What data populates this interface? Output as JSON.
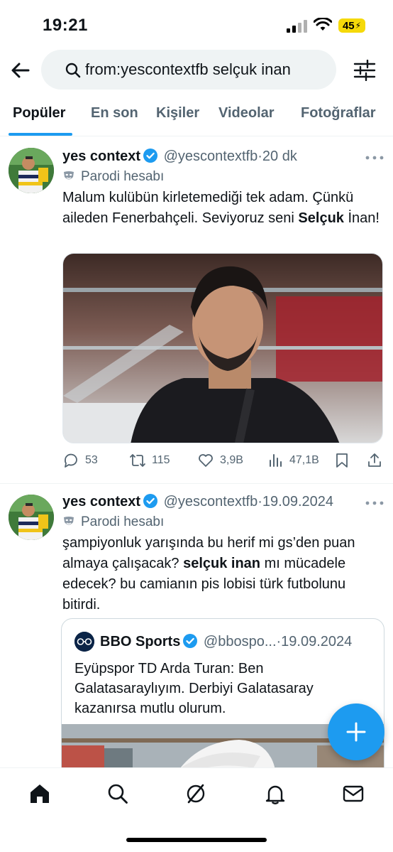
{
  "status_bar": {
    "time": "19:21",
    "battery": "45",
    "icons": [
      "signal-icon",
      "wifi-icon",
      "battery-icon"
    ]
  },
  "search": {
    "query": "from:yescontextfb selçuk inan",
    "icons": [
      "back-arrow-icon",
      "search-icon",
      "filter-sliders-icon"
    ]
  },
  "tabs": [
    {
      "label": "Popüler",
      "active": true
    },
    {
      "label": "En son",
      "active": false
    },
    {
      "label": "Kişiler",
      "active": false
    },
    {
      "label": "Videolar",
      "active": false
    },
    {
      "label": "Fotoğraflar",
      "active": false
    }
  ],
  "tweets": [
    {
      "author": "yes context",
      "handle": "@yescontextfb",
      "separator": "·",
      "time": "20 dk",
      "badge": "Parodi hesabı",
      "text_parts": {
        "before": "Malum kulübün kirletemediği tek adam. Çünkü aileden Fenerbahçeli. Seviyoruz seni ",
        "bold": "Selçuk",
        "after": " İnan!"
      },
      "stats": {
        "replies": "53",
        "retweets": "115",
        "likes": "3,9B",
        "views": "47,1B"
      }
    },
    {
      "author": "yes context",
      "handle": "@yescontextfb",
      "separator": "·",
      "time": "19.09.2024",
      "badge": "Parodi hesabı",
      "text_parts": {
        "before": "şampiyonluk yarışında bu herif mi gs’den puan almaya çalışacak? ",
        "bold": "selçuk inan",
        "after": " mı mücadele edecek? bu camianın pis lobisi türk futbolunu bitirdi."
      },
      "quote": {
        "author": "BBO Sports",
        "handle": "@bbospo...",
        "separator": "·",
        "time": "19.09.2024",
        "text": "Eyüpspor TD Arda Turan: Ben Galatasaraylıyım. Derbiyi Galatasaray kazanırsa mutlu olurum."
      }
    }
  ],
  "bottom_nav": [
    "home-icon",
    "search-icon",
    "grok-icon",
    "notifications-bell-icon",
    "messages-envelope-icon"
  ],
  "colors": {
    "accent": "#1d9bf0",
    "text": "#0f1419",
    "secondary": "#536471",
    "battery": "#f5d90a"
  }
}
